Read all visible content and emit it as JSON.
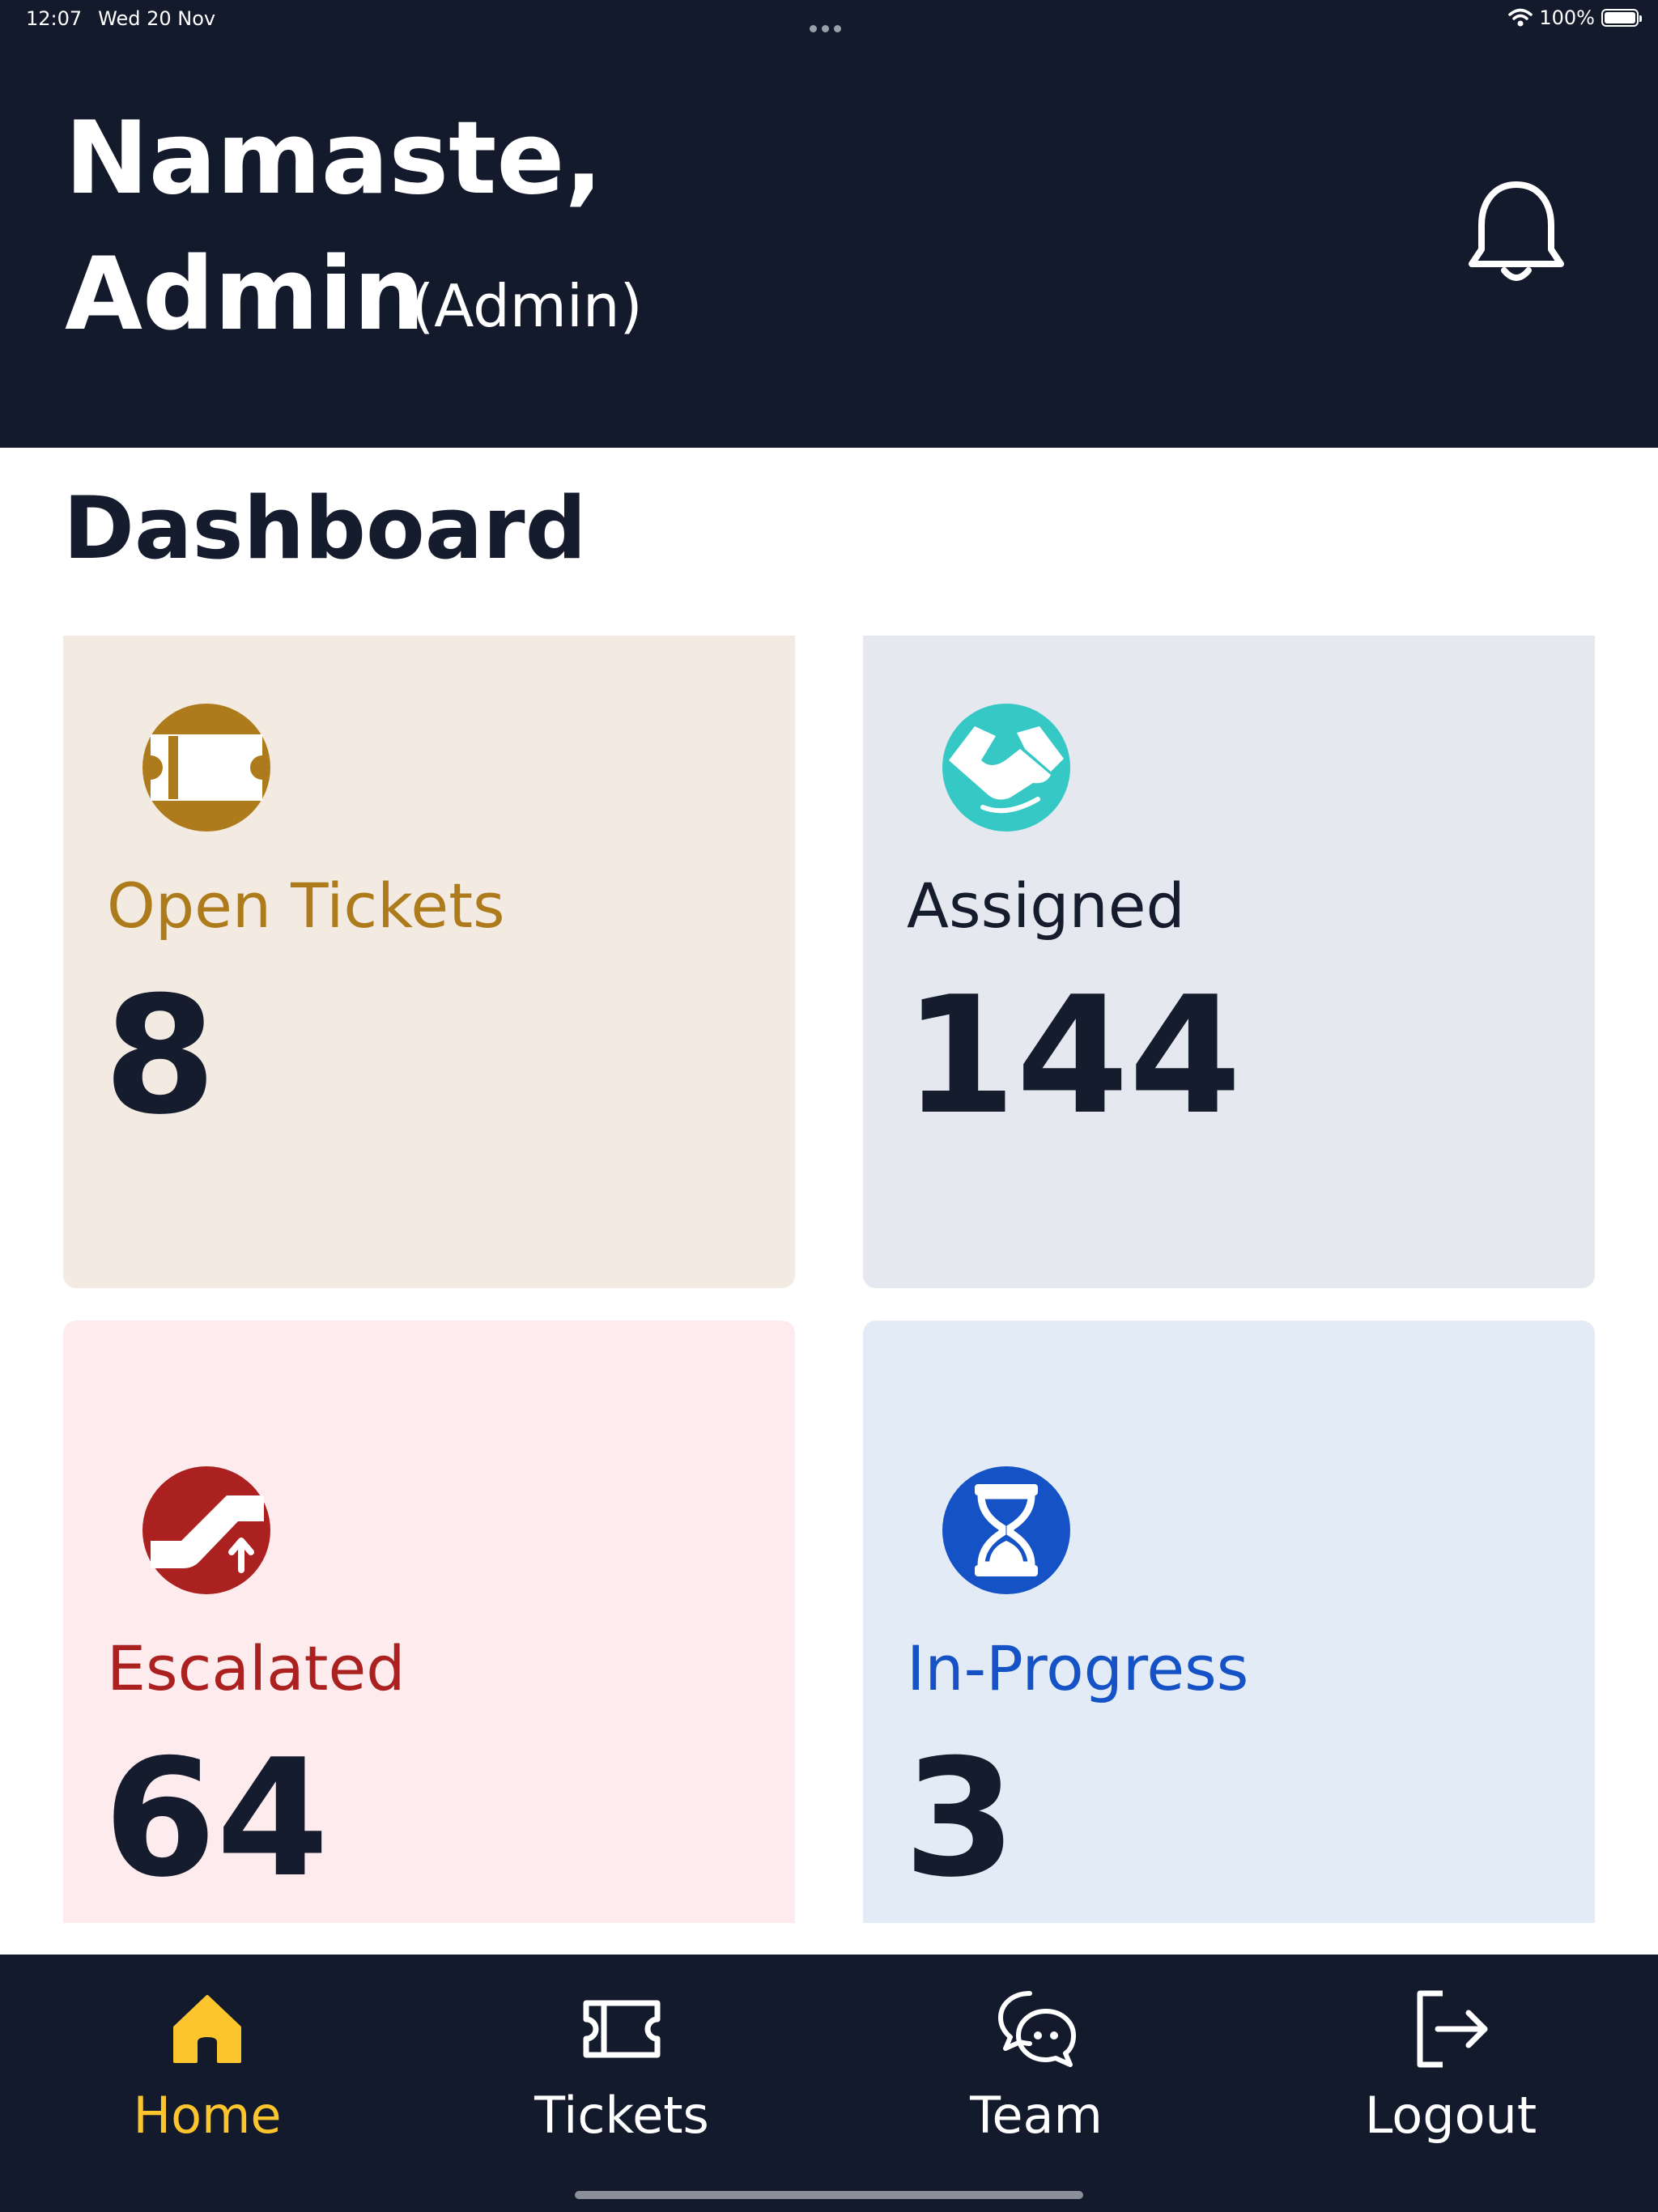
{
  "status_bar": {
    "time": "12:07",
    "date": "Wed 20 Nov",
    "battery": "100%"
  },
  "header": {
    "greeting": "Namaste,",
    "user_name": "Admin",
    "role": "(Admin)"
  },
  "dashboard": {
    "title": "Dashboard",
    "cards": [
      {
        "label": "Open Tickets",
        "value": "8",
        "accent": "#ad7b1b",
        "icon": "ticket-icon"
      },
      {
        "label": "Assigned",
        "value": "144",
        "accent": "#36c8c4",
        "icon": "handshake-icon"
      },
      {
        "label": "Escalated",
        "value": "64",
        "accent": "#ab2120",
        "icon": "escalator-icon"
      },
      {
        "label": "In-Progress",
        "value": "3",
        "accent": "#1452c5",
        "icon": "hourglass-icon"
      }
    ]
  },
  "nav": {
    "active": "Home",
    "active_color": "#fcc52d",
    "items": [
      {
        "label": "Home",
        "icon": "home-icon"
      },
      {
        "label": "Tickets",
        "icon": "ticket-icon"
      },
      {
        "label": "Team",
        "icon": "chat-icon"
      },
      {
        "label": "Logout",
        "icon": "logout-icon"
      }
    ]
  }
}
